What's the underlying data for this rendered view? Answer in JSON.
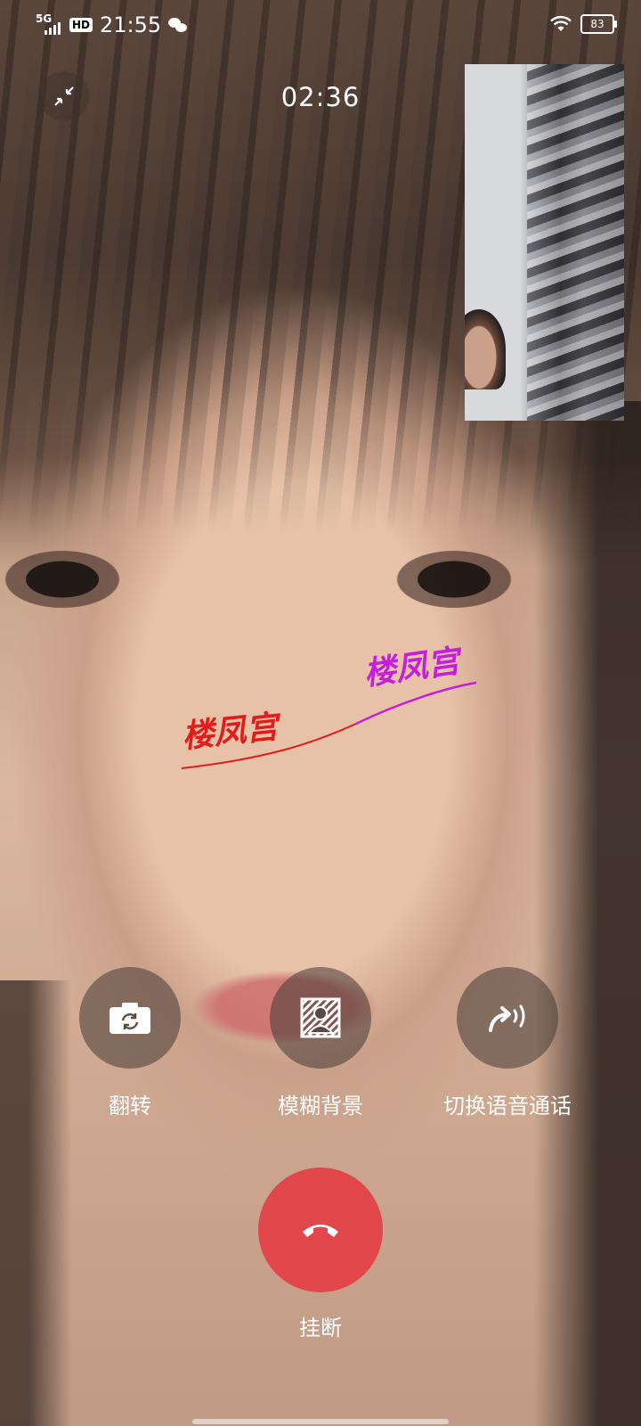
{
  "status_bar": {
    "network": "5G",
    "hd": "HD",
    "time": "21:55",
    "battery": "83",
    "icons": [
      "signal-icon",
      "wechat-icon",
      "wifi-icon",
      "battery-icon"
    ]
  },
  "call": {
    "timer": "02:36"
  },
  "watermark": {
    "text_1": "楼凤宫",
    "text_2": "楼凤宫",
    "color_1": "#e31b1b",
    "color_2": "#c61fdc"
  },
  "actions": {
    "flip_label": "翻转",
    "blur_label": "模糊背景",
    "voice_label": "切换语音通话",
    "hangup_label": "挂断"
  },
  "colors": {
    "hangup": "#e2474c"
  }
}
